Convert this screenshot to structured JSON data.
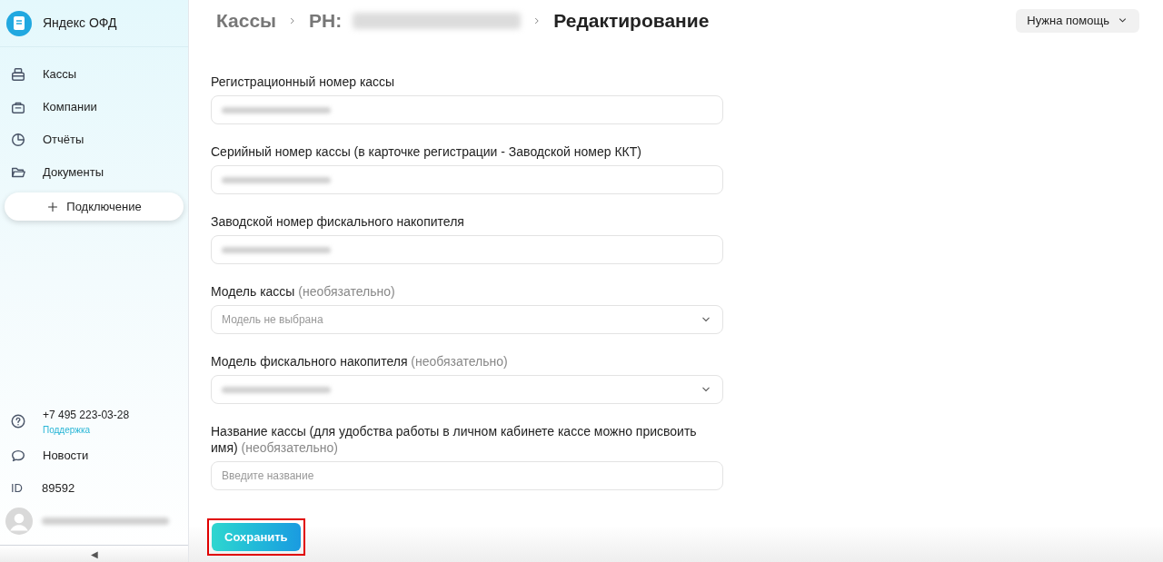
{
  "sidebar": {
    "logo": "Яндекс ОФД",
    "items": [
      {
        "kind": "register",
        "label": "Кассы"
      },
      {
        "kind": "company",
        "label": "Компании"
      },
      {
        "kind": "reports",
        "label": "Отчёты"
      },
      {
        "kind": "documents",
        "label": "Документы"
      }
    ],
    "connect_button": "Подключение",
    "footer": {
      "phone": "+7 495 223-03-28",
      "support_link": "Поддержка",
      "news": "Новости",
      "id_label": "ID",
      "id_value": "89592",
      "user_redacted": true
    },
    "collapse": "◀"
  },
  "breadcrumbs": [
    {
      "label": "Кассы",
      "redacted": false,
      "current": false
    },
    {
      "label": "РН:",
      "redacted": true,
      "current": false
    },
    {
      "label": "Редактирование",
      "redacted": false,
      "current": true
    }
  ],
  "help_button": "Нужна помощь",
  "form": {
    "fields": [
      {
        "kind": "input",
        "label": "Регистрационный номер кассы",
        "redacted": true
      },
      {
        "kind": "input",
        "label": "Серийный номер кассы (в карточке регистрации - Заводской номер ККТ)",
        "redacted": true
      },
      {
        "kind": "input",
        "label": "Заводской номер фискального накопителя",
        "redacted": true
      },
      {
        "kind": "select",
        "label": "Модель кассы",
        "optional": "(необязательно)",
        "placeholder": "Модель не выбрана"
      },
      {
        "kind": "select",
        "label": "Модель фискального накопителя",
        "optional": "(необязательно)",
        "redacted": true
      },
      {
        "kind": "input",
        "label": "Название кассы (для удобства работы в личном кабинете кассе можно присвоить имя)",
        "optional": "(необязательно)",
        "placeholder": "Введите название"
      }
    ],
    "save_button": {
      "label": "Сохранить",
      "highlighted": true
    }
  }
}
